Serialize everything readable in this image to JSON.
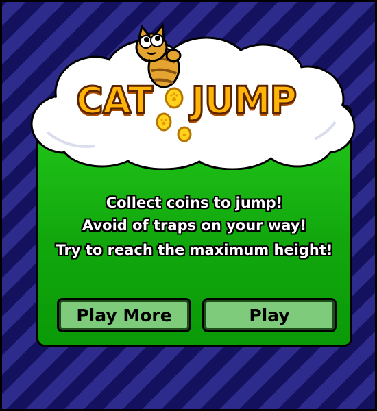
{
  "game": {
    "title_part1": "CAT",
    "title_part2": "JUMP",
    "instructions": [
      "Collect coins to jump!",
      "Avoid of traps on your way!",
      "Try to reach the maximum height!"
    ],
    "buttons": {
      "play_more": "Play More",
      "play": "Play"
    }
  },
  "icons": {
    "character": "cat-character-icon",
    "coin": "paw-coin-icon"
  },
  "colors": {
    "background_stripe_dark": "#14125e",
    "background_stripe_light": "#2d2c8c",
    "panel_green": "#12a80d",
    "button_green": "#7fcb7c",
    "title_orange": "#ffb40a",
    "coin_yellow": "#ffd21c"
  }
}
